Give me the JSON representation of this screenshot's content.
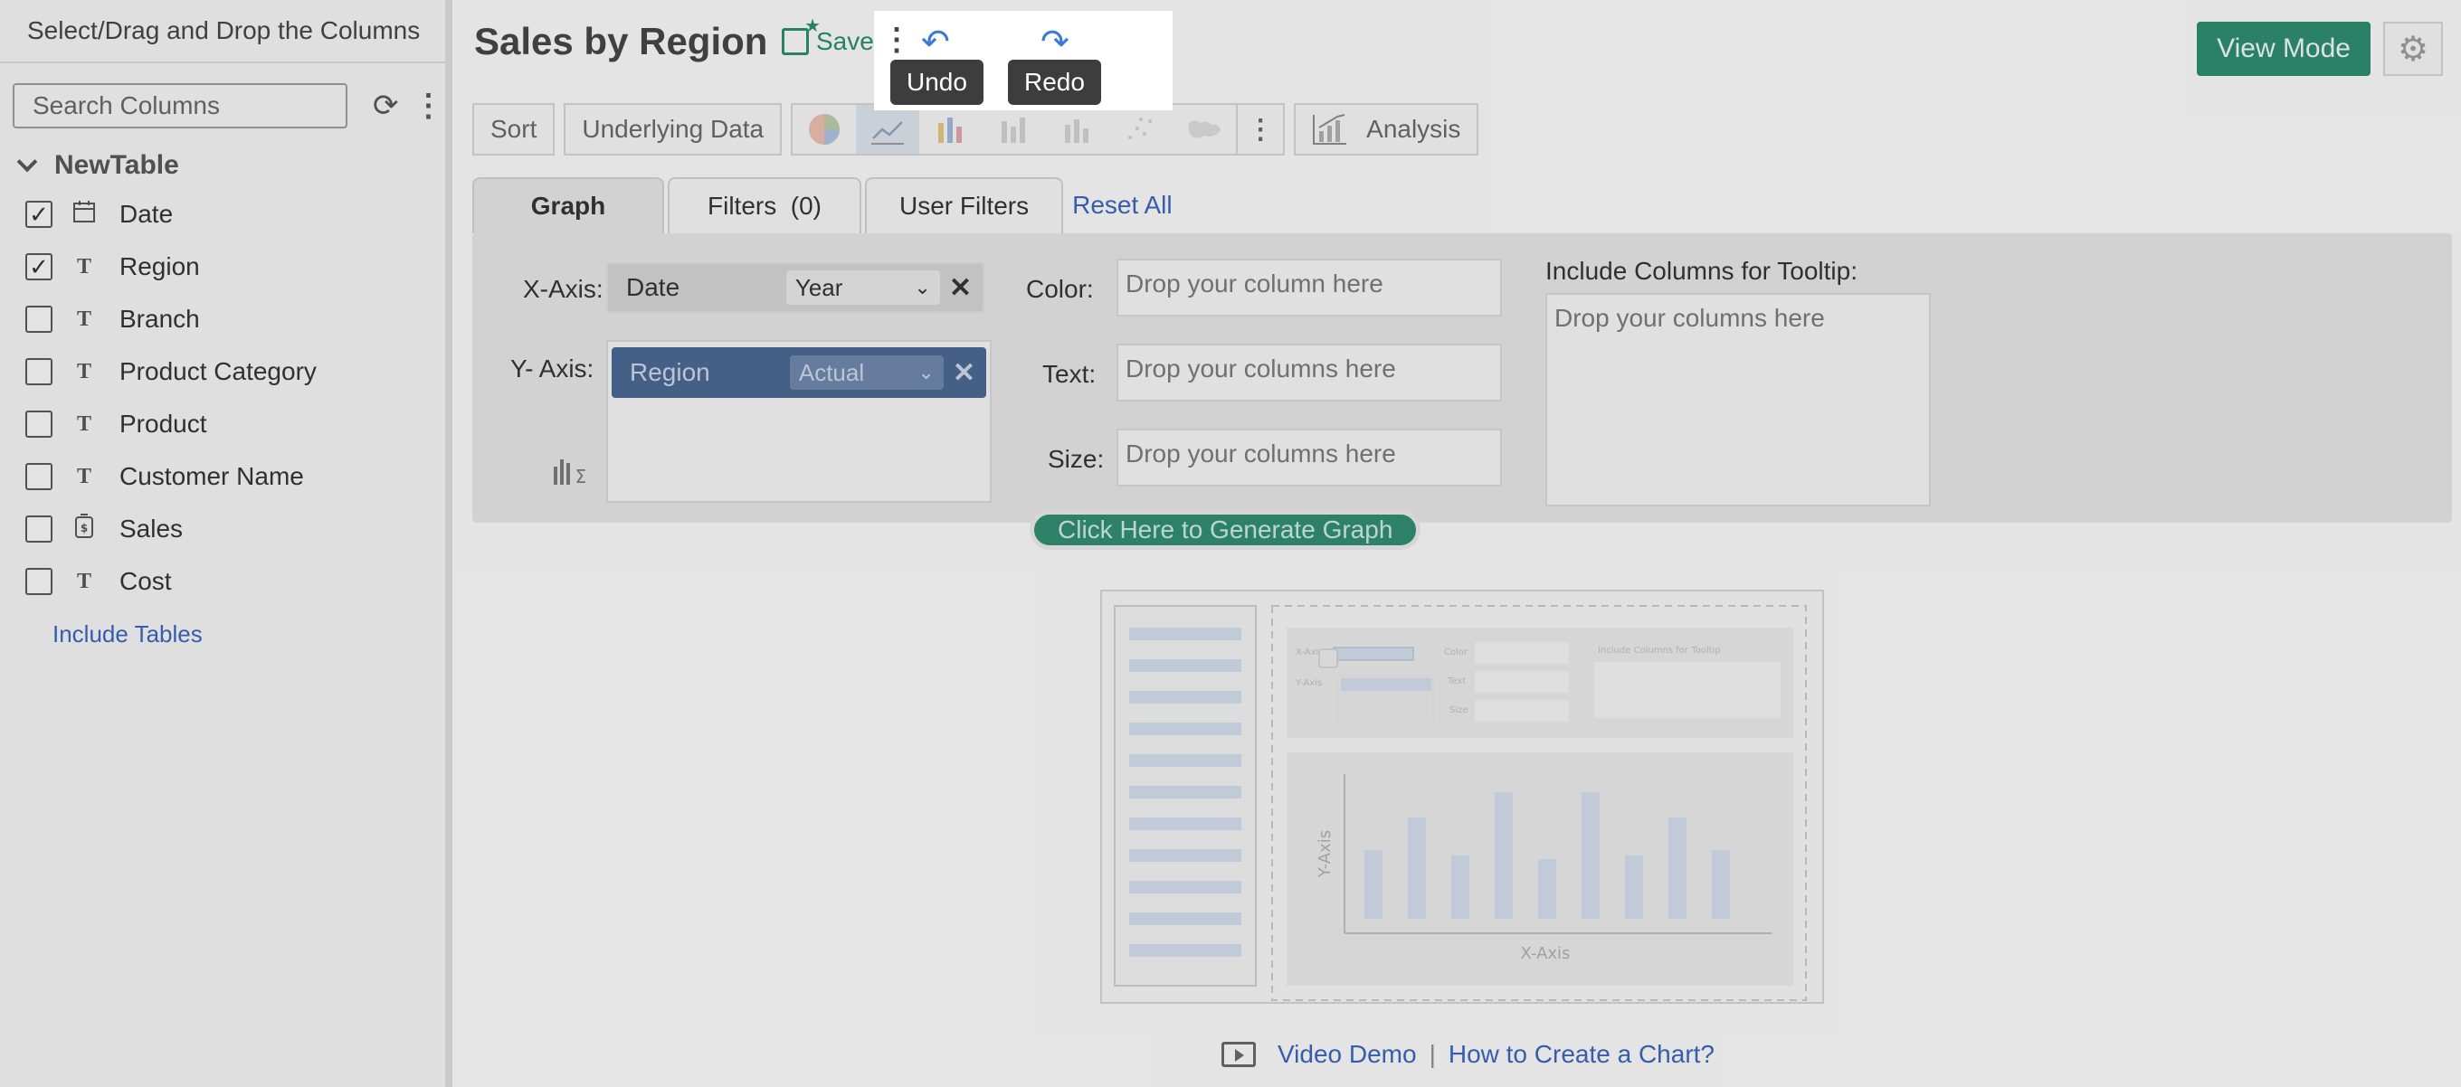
{
  "sidebar": {
    "header": "Select/Drag and Drop the Columns",
    "search_placeholder": "Search Columns",
    "table_name": "NewTable",
    "columns": [
      {
        "label": "Date",
        "checked": true,
        "type_icon": "calendar-icon"
      },
      {
        "label": "Region",
        "checked": true,
        "type_icon": "text-type-icon"
      },
      {
        "label": "Branch",
        "checked": false,
        "type_icon": "text-type-icon"
      },
      {
        "label": "Product Category",
        "checked": false,
        "type_icon": "text-type-icon"
      },
      {
        "label": "Product",
        "checked": false,
        "type_icon": "text-type-icon"
      },
      {
        "label": "Customer Name",
        "checked": false,
        "type_icon": "text-type-icon"
      },
      {
        "label": "Sales",
        "checked": false,
        "type_icon": "currency-icon"
      },
      {
        "label": "Cost",
        "checked": false,
        "type_icon": "text-type-icon"
      }
    ],
    "include_tables": "Include Tables"
  },
  "header": {
    "title": "Sales by Region",
    "save_label": "Save",
    "view_mode_label": "View Mode",
    "undo_tooltip": "Undo",
    "redo_tooltip": "Redo"
  },
  "toolbar": {
    "sort": "Sort",
    "underlying_data": "Underlying Data",
    "analysis": "Analysis"
  },
  "tabs": {
    "graph": "Graph",
    "filters": "Filters  (0)",
    "user_filters": "User Filters",
    "reset_all": "Reset All"
  },
  "axes": {
    "x_label": "X-Axis:",
    "x_column": "Date",
    "x_agg": "Year",
    "y_label": "Y- Axis:",
    "y_column": "Region",
    "y_agg": "Actual",
    "color_label": "Color:",
    "color_placeholder": "Drop your column here",
    "text_label": "Text:",
    "text_placeholder": "Drop your columns here",
    "size_label": "Size:",
    "size_placeholder": "Drop your columns here",
    "tooltip_label": "Include Columns for Tooltip:",
    "tooltip_placeholder": "Drop your columns here",
    "generate_button": "Click Here to Generate Graph"
  },
  "illustration": {
    "x_axis": "X-Axis",
    "y_axis": "Y-Axis",
    "mini_x_label": "X-Axis",
    "mini_y_label": "Y-Axis",
    "mini_color": "Color",
    "mini_text": "Text",
    "mini_size": "Size",
    "mini_tooltip": "Include Columns for Tooltip"
  },
  "footer": {
    "video_demo": "Video Demo",
    "separator": "|",
    "how_to": "How to Create a Chart?"
  },
  "colors": {
    "accent_green": "#2d8a6c",
    "link_blue": "#3a63b8",
    "y_pill": "#4a6690"
  }
}
